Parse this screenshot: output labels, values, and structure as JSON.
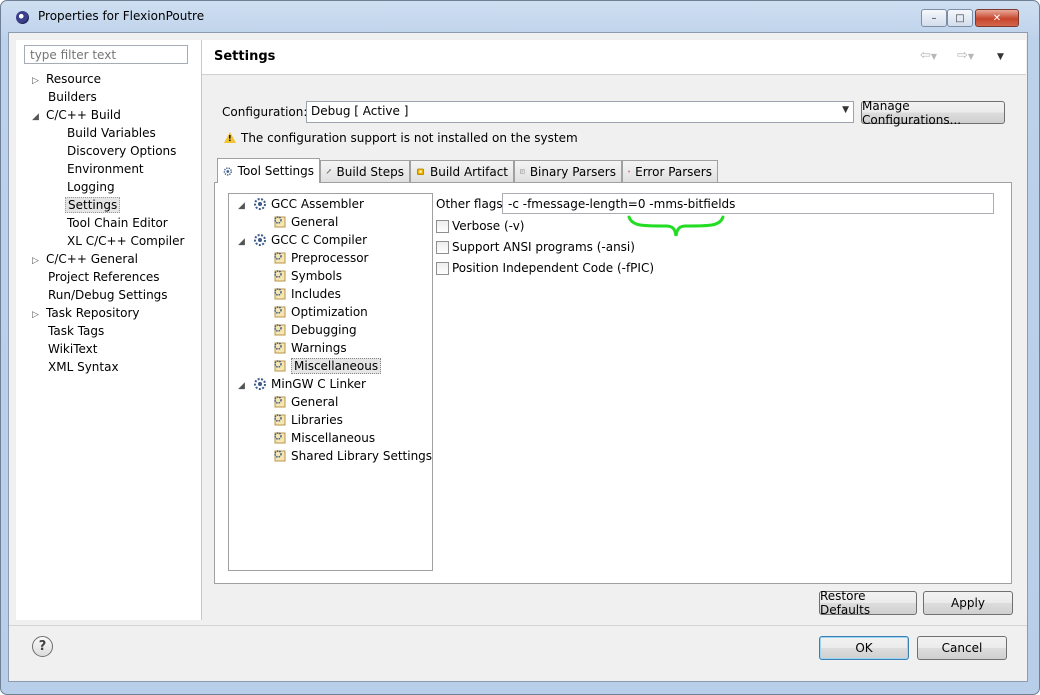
{
  "window": {
    "title": "Properties for FlexionPoutre",
    "controls": {
      "minimize": "–",
      "maximize": "□",
      "close": "✕"
    }
  },
  "nav": {
    "filter_placeholder": "type filter text",
    "items": [
      {
        "label": "Resource",
        "expander": "▷"
      },
      {
        "label": "Builders"
      },
      {
        "label": "C/C++ Build",
        "expander": "◢"
      },
      {
        "label": "Build Variables"
      },
      {
        "label": "Discovery Options"
      },
      {
        "label": "Environment"
      },
      {
        "label": "Logging"
      },
      {
        "label": "Settings"
      },
      {
        "label": "Tool Chain Editor"
      },
      {
        "label": "XL C/C++ Compiler"
      },
      {
        "label": "C/C++ General",
        "expander": "▷"
      },
      {
        "label": "Project References"
      },
      {
        "label": "Run/Debug Settings"
      },
      {
        "label": "Task Repository",
        "expander": "▷"
      },
      {
        "label": "Task Tags"
      },
      {
        "label": "WikiText"
      },
      {
        "label": "XML Syntax"
      }
    ]
  },
  "header": {
    "title": "Settings",
    "icons": [
      "back-arrow-icon",
      "forward-arrow-icon",
      "view-menu-icon"
    ]
  },
  "config": {
    "label": "Configuration:",
    "value": "Debug  [ Active ]",
    "manage_button": "Manage Configurations...",
    "warning": "The configuration support is not installed on the system"
  },
  "tabs": [
    {
      "label": "Tool Settings",
      "icon": "tool-settings-icon"
    },
    {
      "label": "Build Steps",
      "icon": "build-steps-icon"
    },
    {
      "label": "Build Artifact",
      "icon": "build-artifact-icon"
    },
    {
      "label": "Binary Parsers",
      "icon": "binary-parsers-icon"
    },
    {
      "label": "Error Parsers",
      "icon": "error-parsers-icon"
    }
  ],
  "tree": {
    "groups": [
      {
        "label": "GCC Assembler",
        "children": [
          "General"
        ]
      },
      {
        "label": "GCC C Compiler",
        "children": [
          "Preprocessor",
          "Symbols",
          "Includes",
          "Optimization",
          "Debugging",
          "Warnings",
          "Miscellaneous"
        ]
      },
      {
        "label": "MinGW C Linker",
        "children": [
          "General",
          "Libraries",
          "Miscellaneous",
          "Shared Library Settings"
        ]
      }
    ],
    "selected": "Miscellaneous"
  },
  "options": {
    "other_flags_label": "Other flags",
    "other_flags_value": "-c -fmessage-length=0 -mms-bitfields",
    "verbose": "Verbose (-v)",
    "ansi": "Support ANSI programs (-ansi)",
    "fpic": "Position Independent Code (-fPIC)"
  },
  "buttons": {
    "restore_defaults": "Restore Defaults",
    "apply": "Apply",
    "help": "?",
    "ok": "OK",
    "cancel": "Cancel"
  },
  "colors": {
    "annotation_brace": "#22dd22"
  }
}
